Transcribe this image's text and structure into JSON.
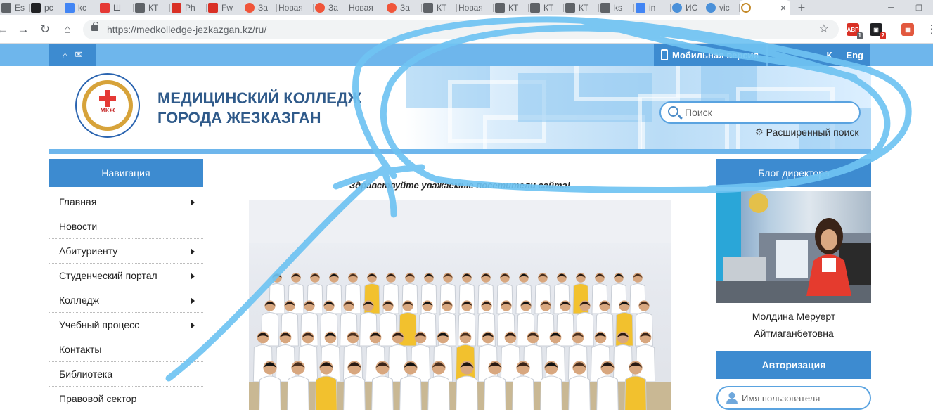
{
  "browser": {
    "tabs": [
      {
        "title": "Es",
        "icon": "blank-page-icon",
        "color": "#5f6368"
      },
      {
        "title": "pc",
        "icon": "github-icon",
        "color": "#202124"
      },
      {
        "title": "kc",
        "icon": "google-icon",
        "color": "#4285f4"
      },
      {
        "title": "Ш",
        "icon": "colorful-flag-icon",
        "color": "#e53935"
      },
      {
        "title": "КТ",
        "icon": "document-icon",
        "color": "#5f6368"
      },
      {
        "title": "Ph",
        "icon": "pdf-icon",
        "color": "#d93025"
      },
      {
        "title": "Fw",
        "icon": "gmail-icon",
        "color": "#d93025"
      },
      {
        "title": "За",
        "icon": "red-circle-icon",
        "color": "#f0553a"
      },
      {
        "title": "Новая",
        "icon": "",
        "color": ""
      },
      {
        "title": "За",
        "icon": "red-circle-icon",
        "color": "#f0553a"
      },
      {
        "title": "Новая",
        "icon": "",
        "color": ""
      },
      {
        "title": "За",
        "icon": "red-circle-icon",
        "color": "#f0553a"
      },
      {
        "title": "КТ",
        "icon": "document-icon",
        "color": "#5f6368"
      },
      {
        "title": "Новая",
        "icon": "",
        "color": ""
      },
      {
        "title": "КТ",
        "icon": "document-icon",
        "color": "#5f6368"
      },
      {
        "title": "КТ",
        "icon": "document-icon",
        "color": "#5f6368"
      },
      {
        "title": "КТ",
        "icon": "document-icon",
        "color": "#5f6368"
      },
      {
        "title": "ks",
        "icon": "document-icon",
        "color": "#5f6368"
      },
      {
        "title": "in",
        "icon": "google-icon",
        "color": "#4285f4"
      },
      {
        "title": "ИС",
        "icon": "globe-icon",
        "color": "#4a90d9"
      },
      {
        "title": "vic",
        "icon": "globe-icon",
        "color": "#4a90d9"
      },
      {
        "title": "",
        "icon": "college-favicon-icon",
        "color": "#d7a33a",
        "active": true
      }
    ],
    "url_host": "https://medkolledge-jezkazgan.kz",
    "url_path": "/ru/",
    "extensions": [
      {
        "icon": "adblock-icon",
        "color": "#d93025",
        "badge": "1"
      },
      {
        "icon": "extension-icon",
        "color": "#202124",
        "badge": "2"
      },
      {
        "icon": "extension-grid-icon",
        "color": "#e2583e",
        "badge": ""
      }
    ]
  },
  "site": {
    "mobile_label": "Мобильная версия",
    "lang_partial": "К",
    "lang_eng": "Eng",
    "title_line1": "МЕДИЦИНСКИЙ КОЛЛЕДЖ",
    "title_line2": "ГОРОДА ЖЕЗКАЗГАН",
    "logo_abbr": "МКЖ",
    "search_placeholder": "Поиск",
    "advanced_search": "Расширенный поиск",
    "nav_title": "Навигация",
    "nav_items": [
      {
        "label": "Главная",
        "has_sub": true
      },
      {
        "label": "Новости",
        "has_sub": false
      },
      {
        "label": "Абитуриенту",
        "has_sub": true
      },
      {
        "label": "Студенческий портал",
        "has_sub": true
      },
      {
        "label": "Колледж",
        "has_sub": true
      },
      {
        "label": "Учебный процесс",
        "has_sub": true
      },
      {
        "label": "Контакты",
        "has_sub": false
      },
      {
        "label": "Библиотека",
        "has_sub": false
      },
      {
        "label": "Правовой сектор",
        "has_sub": false
      }
    ],
    "welcome": "Здравствуйте уважаемые посетители сайта!",
    "blog_title": "Блог директора",
    "director_name_line1": "Молдина Меруерт",
    "director_name_line2": "Айтмаганбетовна",
    "auth_title": "Авторизация",
    "username_placeholder": "Имя пользователя"
  },
  "colors": {
    "accent_dark": "#3d8bd0",
    "accent_light": "#6eb6ec",
    "title": "#2f5a8a",
    "annotation": "#6fc3f2"
  }
}
